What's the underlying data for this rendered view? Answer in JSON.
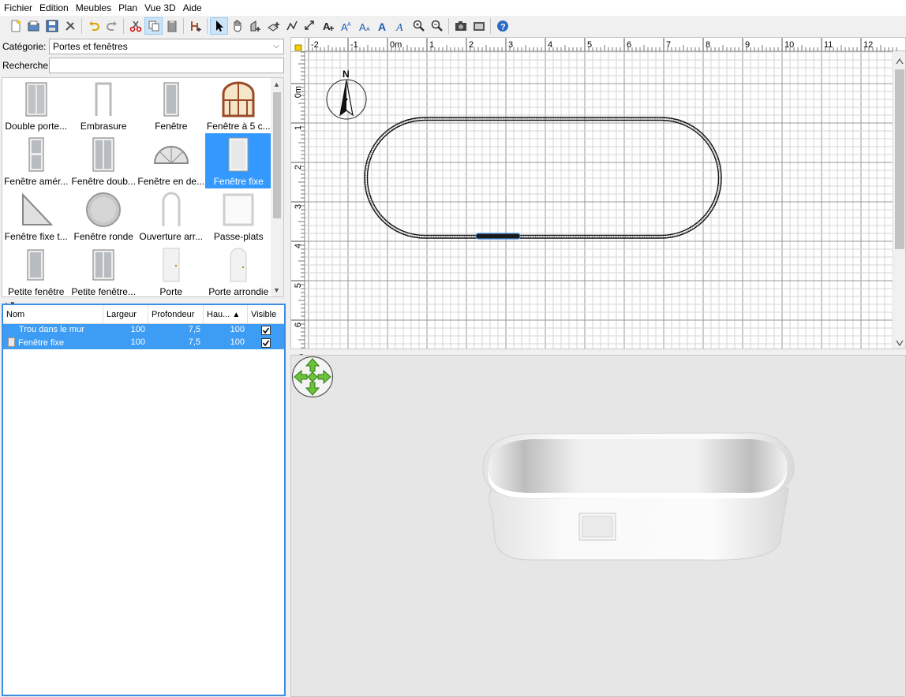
{
  "menu": [
    "Fichier",
    "Edition",
    "Meubles",
    "Plan",
    "Vue 3D",
    "Aide"
  ],
  "toolbar": {
    "buttons": [
      "new-icon",
      "open-icon",
      "save-icon",
      "preferences-icon",
      "undo-icon",
      "redo-icon",
      "cut-icon",
      "copy-icon",
      "paste-icon",
      "add-furniture-icon",
      "select-icon",
      "pan-icon",
      "create-walls-icon",
      "create-rooms-icon",
      "create-polylines-icon",
      "create-dimensions-icon",
      "add-text-icon",
      "text-bold-icon",
      "text-italic-icon",
      "text-increase-icon",
      "text-decrease-icon",
      "zoom-in-icon",
      "zoom-out-icon",
      "photo-icon",
      "video-icon",
      "help-icon"
    ]
  },
  "catalog": {
    "category_label": "Catégorie:",
    "category_value": "Portes et fenêtres",
    "search_label": "Recherche:",
    "search_value": "",
    "items": [
      {
        "label": "Double porte...",
        "icon": "double-door-icon"
      },
      {
        "label": "Embrasure",
        "icon": "doorframe-icon"
      },
      {
        "label": "Fenêtre",
        "icon": "window-icon"
      },
      {
        "label": "Fenêtre à 5 c...",
        "icon": "window-5-panes-icon"
      },
      {
        "label": "Fenêtre amér...",
        "icon": "american-window-icon"
      },
      {
        "label": "Fenêtre doub...",
        "icon": "double-window-icon"
      },
      {
        "label": "Fenêtre en de...",
        "icon": "half-round-window-icon"
      },
      {
        "label": "Fenêtre fixe",
        "icon": "fixed-window-icon",
        "selected": true
      },
      {
        "label": "Fenêtre fixe t...",
        "icon": "triangle-window-icon"
      },
      {
        "label": "Fenêtre ronde",
        "icon": "round-window-icon"
      },
      {
        "label": "Ouverture arr...",
        "icon": "arched-opening-icon"
      },
      {
        "label": "Passe-plats",
        "icon": "service-hatch-icon"
      },
      {
        "label": "Petite fenêtre",
        "icon": "small-window-icon"
      },
      {
        "label": "Petite fenêtre...",
        "icon": "small-window-2-icon"
      },
      {
        "label": "Porte",
        "icon": "door-icon"
      },
      {
        "label": "Porte arrondie",
        "icon": "rounded-door-icon"
      }
    ]
  },
  "furniture_table": {
    "headers": [
      "Nom",
      "Largeur",
      "Profondeur",
      "Hau...",
      "Visible"
    ],
    "rows": [
      {
        "name": "Trou dans le mur",
        "width": "100",
        "depth": "7,5",
        "height": "100",
        "visible": true
      },
      {
        "name": "Fenêtre fixe",
        "width": "100",
        "depth": "7,5",
        "height": "100",
        "visible": true
      }
    ]
  },
  "plan": {
    "ruler_x": [
      "-2",
      "-1",
      "0m",
      "1",
      "2",
      "3",
      "4",
      "5",
      "6",
      "7",
      "8",
      "9",
      "10",
      "11",
      "12"
    ],
    "ruler_y": [
      "0m",
      "1",
      "2",
      "3",
      "4",
      "5",
      "6"
    ],
    "compass_label": "N"
  }
}
